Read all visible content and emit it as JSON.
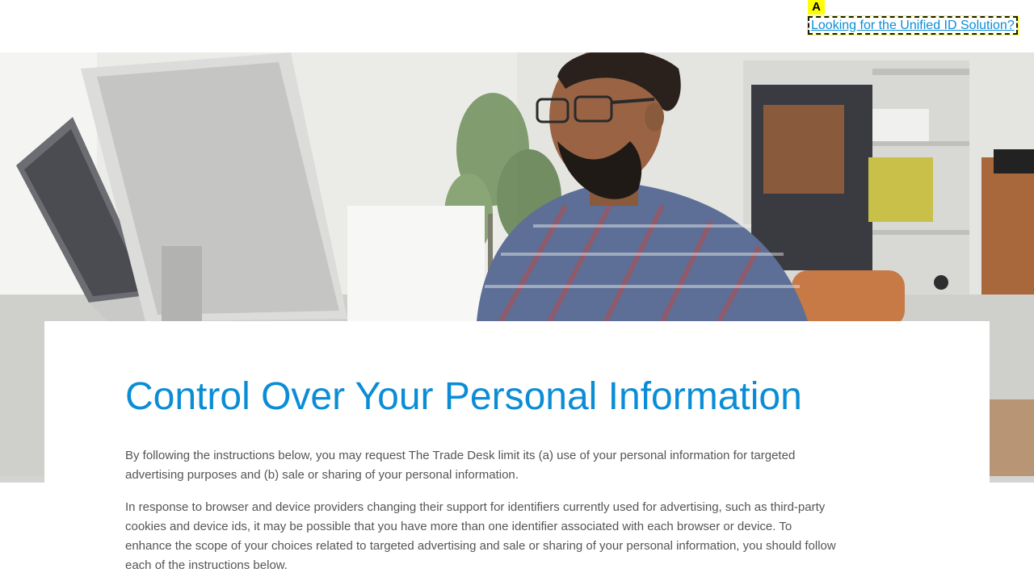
{
  "header": {
    "marker_label": "A",
    "uid_link_text": "Looking for the Unified ID Solution?"
  },
  "hero": {
    "image_description_icon": "office-photo"
  },
  "content": {
    "title": "Control Over Your Personal Information",
    "paragraphs": [
      "By following the instructions below, you may request The Trade Desk limit its (a) use of your personal information for targeted advertising purposes and (b) sale or sharing of your personal information.",
      "In response to browser and device providers changing their support for identifiers currently used for advertising, such as third-party cookies and device ids, it may be possible that you have more than one identifier associated with each browser or device. To enhance the scope of your choices related to targeted advertising and sale or sharing of your personal information, you should follow each of the instructions below."
    ]
  },
  "colors": {
    "accent": "#0b8dd6",
    "highlight": "#ffff00",
    "body_text": "#555555"
  }
}
